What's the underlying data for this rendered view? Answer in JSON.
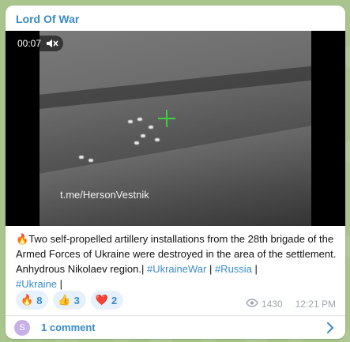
{
  "channel": {
    "name": "Lord Of War"
  },
  "video": {
    "time": "00:07",
    "watermark": "t.me/HersonVestnik"
  },
  "post": {
    "fire_emoji": "🔥",
    "text": "Two self-propelled artillery installations from the 28th brigade of the Armed Forces of Ukraine were destroyed in the area of  the settlement. Anhydrous Nikolaev region.| ",
    "tags": [
      "#UkraineWar",
      "#Russia",
      "#Ukraine"
    ],
    "sep1": " | ",
    "sep2": " |",
    "sep3": " |"
  },
  "reactions": [
    {
      "emoji": "🔥",
      "count": "8"
    },
    {
      "emoji": "👍",
      "count": "3"
    },
    {
      "emoji": "❤️",
      "count": "2"
    }
  ],
  "meta": {
    "views": "1430",
    "time": "12:21 PM"
  },
  "comments": {
    "avatar_letter": "S",
    "label": "1 comment"
  },
  "colors": {
    "accent": "#3a8bc8",
    "crosshair": "#3ed13e",
    "avatar": "#c6b0e6"
  }
}
